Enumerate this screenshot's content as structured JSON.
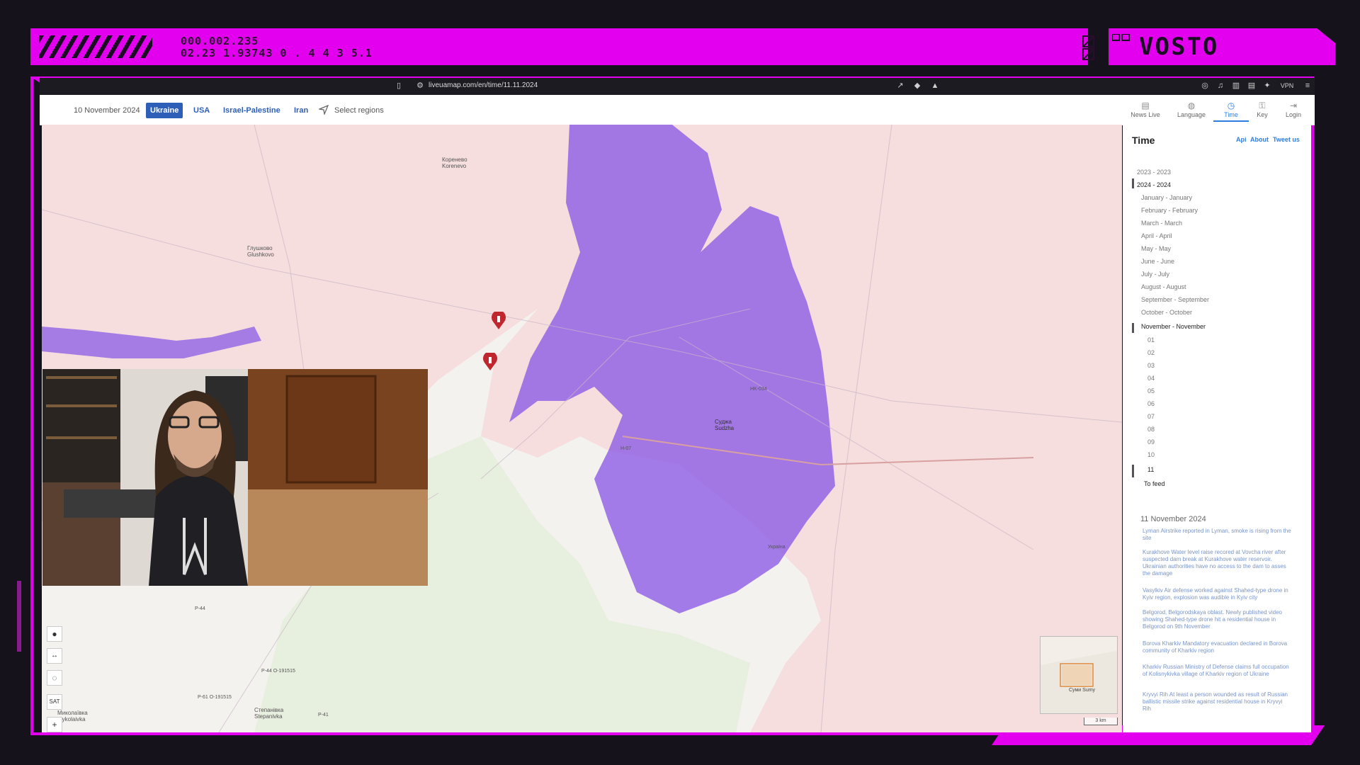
{
  "hud": {
    "readout_line1": "000.002.235",
    "readout_line2": "02.23 1.93743  0  .  4  4  3  5.1",
    "brand": "VOSTO"
  },
  "browser": {
    "url": "liveuamap.com/en/time/11.11.2024",
    "vpn_label": "VPN"
  },
  "nav": {
    "date": "10 November 2024",
    "tabs": [
      "Ukraine",
      "USA",
      "Israel-Palestine",
      "Iran"
    ],
    "select_regions": "Select regions",
    "right": [
      {
        "label": "News Live",
        "icon": "news-icon"
      },
      {
        "label": "Language",
        "icon": "globe-icon"
      },
      {
        "label": "Time",
        "icon": "clock-icon"
      },
      {
        "label": "Key",
        "icon": "key-icon"
      },
      {
        "label": "Login",
        "icon": "login-icon"
      }
    ]
  },
  "sidebar": {
    "title": "Time",
    "links": [
      "Api",
      "About",
      "Tweet us"
    ],
    "years": [
      "2023 - 2023",
      "2024 - 2024"
    ],
    "months": [
      "January - January",
      "February - February",
      "March - March",
      "April - April",
      "May - May",
      "June - June",
      "July - July",
      "August - August",
      "September - September",
      "October - October",
      "November - November"
    ],
    "days": [
      "01",
      "02",
      "03",
      "04",
      "05",
      "06",
      "07",
      "08",
      "09",
      "10",
      "11"
    ],
    "to_feed": "To feed",
    "news_date": "11 November 2024",
    "news": [
      "Lyman Airstrike reported in Lyman, smoke is rising from the site",
      "Kurakhove Water level raise recored at Vovcha river after suspected dam break at Kurakhove water reservoir. Ukrainian authorities have no access to the dam to asses the damage",
      "Vasylkiv Air defense worked against Shahed-type drone in Kyiv region, explosion was audible in Kyiv city",
      "Belgorod, Belgorodskaya oblast. Newly published video showing Shahed-type drone hit a residential house in Belgorod on 9th November",
      "Borova Kharkiv Mandatory evacuation declared in Borova community of Kharkiv region",
      "Kharkiv Russian Ministry of Defense claims full occupation of Kolisnykivka village of Kharkiv region of Ukraine",
      "Kryvyi Rih At least a person wounded as result of Russian ballistic missile strike against residential house in Kryvyi Rih"
    ]
  },
  "map": {
    "labels": {
      "korenevo": "Кореневo Korenevo",
      "glushkovo": "Глушково Glushkovo",
      "sudzha": "Суджа Sudzha",
      "road1": "Н-07",
      "road2": "Р-44",
      "road3": "Р-61 О-191515",
      "road4": "Р-41",
      "road5": "Р-44 О-191515",
      "stepanivka": "Степанівка Stepanivka",
      "mykolaivka": "Миколаївка Mykolaivka",
      "hk": "HK-034",
      "ukraine_label": "Україна",
      "sumy": "Суми Sumy"
    },
    "occupied_color": "#8a5ae6",
    "marker_color": "#c0262d",
    "scale_label": "3 km",
    "controls": [
      "dot-icon",
      "measure-icon",
      "eye-icon",
      "SAT",
      "+"
    ]
  },
  "colors": {
    "hud_accent": "#e200ef",
    "link_blue": "#2d7de0",
    "active_tab": "#2d5eb8"
  }
}
